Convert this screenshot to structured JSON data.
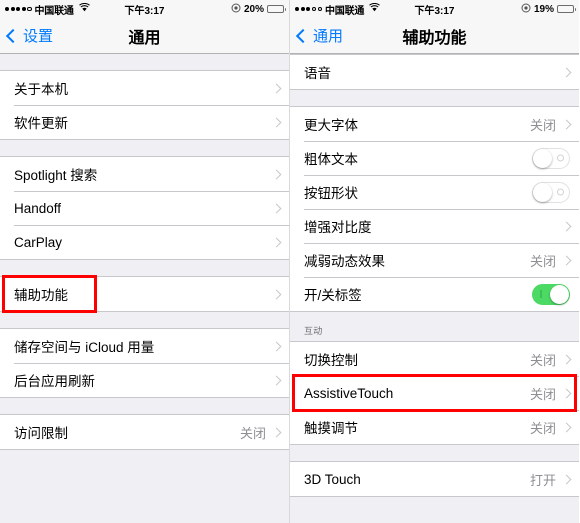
{
  "colors": {
    "accent": "#007aff",
    "highlight": "#ff0000",
    "switch_on": "#4cd964",
    "battery_low": "#ff3b30",
    "value_text": "#8e8e93"
  },
  "left_screen": {
    "status": {
      "carrier": "中国联通",
      "signal_filled": 4,
      "signal_empty": 1,
      "wifi_icon": "wifi-icon",
      "time": "下午3:17",
      "alarm_icon": "alarm-clock-icon",
      "battery_percent": "20%",
      "battery_level": 20
    },
    "nav": {
      "back_label": "设置",
      "back_icon": "chevron-left-icon",
      "title": "通用"
    },
    "sections": [
      {
        "header": "",
        "rows": [
          {
            "label": "关于本机",
            "value": "",
            "accessory": "chevron"
          },
          {
            "label": "软件更新",
            "value": "",
            "accessory": "chevron"
          }
        ]
      },
      {
        "header": "",
        "rows": [
          {
            "label": "Spotlight 搜索",
            "value": "",
            "accessory": "chevron"
          },
          {
            "label": "Handoff",
            "value": "",
            "accessory": "chevron"
          },
          {
            "label": "CarPlay",
            "value": "",
            "accessory": "chevron"
          }
        ]
      },
      {
        "header": "",
        "rows": [
          {
            "label": "辅助功能",
            "value": "",
            "accessory": "chevron",
            "highlighted": true
          }
        ]
      },
      {
        "header": "",
        "rows": [
          {
            "label": "储存空间与 iCloud 用量",
            "value": "",
            "accessory": "chevron"
          },
          {
            "label": "后台应用刷新",
            "value": "",
            "accessory": "chevron"
          }
        ]
      },
      {
        "header": "",
        "rows": [
          {
            "label": "访问限制",
            "value": "关闭",
            "accessory": "chevron"
          }
        ]
      }
    ]
  },
  "right_screen": {
    "status": {
      "carrier": "中国联通",
      "signal_filled": 3,
      "signal_empty": 2,
      "wifi_icon": "wifi-icon",
      "time": "下午3:17",
      "alarm_icon": "alarm-clock-icon",
      "battery_percent": "19%",
      "battery_level": 19
    },
    "nav": {
      "back_label": "通用",
      "back_icon": "chevron-left-icon",
      "title": "辅助功能"
    },
    "sections": [
      {
        "header": "",
        "rows": [
          {
            "label": "语音",
            "value": "",
            "accessory": "chevron"
          }
        ]
      },
      {
        "header": "",
        "rows": [
          {
            "label": "更大字体",
            "value": "关闭",
            "accessory": "chevron"
          },
          {
            "label": "粗体文本",
            "value": "",
            "accessory": "switch",
            "switch_on": false
          },
          {
            "label": "按钮形状",
            "value": "",
            "accessory": "switch",
            "switch_on": false
          },
          {
            "label": "增强对比度",
            "value": "",
            "accessory": "chevron"
          },
          {
            "label": "减弱动态效果",
            "value": "关闭",
            "accessory": "chevron"
          },
          {
            "label": "开/关标签",
            "value": "",
            "accessory": "switch",
            "switch_on": true
          }
        ]
      },
      {
        "header": "互动",
        "rows": [
          {
            "label": "切换控制",
            "value": "关闭",
            "accessory": "chevron"
          },
          {
            "label": "AssistiveTouch",
            "value": "关闭",
            "accessory": "chevron",
            "highlighted": true
          },
          {
            "label": "触摸调节",
            "value": "关闭",
            "accessory": "chevron"
          }
        ]
      },
      {
        "header": "",
        "rows": [
          {
            "label": "3D Touch",
            "value": "打开",
            "accessory": "chevron"
          }
        ]
      }
    ]
  }
}
